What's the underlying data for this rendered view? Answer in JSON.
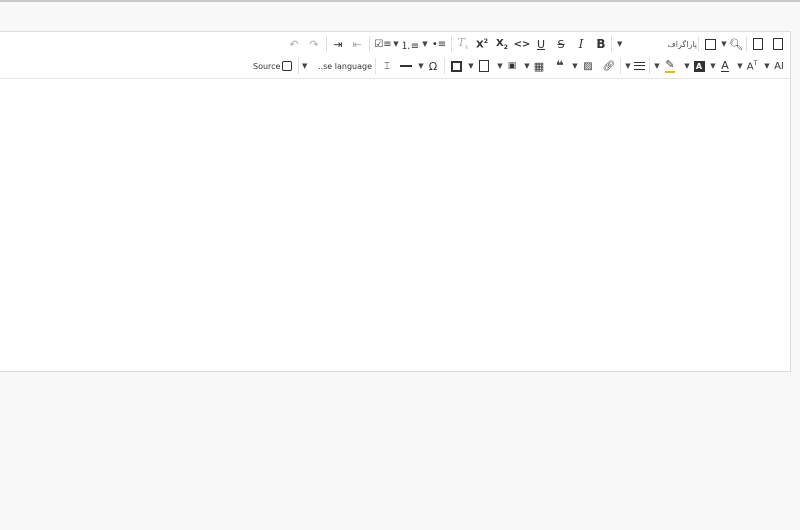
{
  "toolbar": {
    "row1": {
      "source_doc_label": "",
      "format_dropdown_label": "پاراگراف"
    },
    "row2": {
      "source_label": "Source",
      "language_label": "..se language",
      "ai_label": "AI"
    }
  },
  "colors": {
    "background": "#f8f8f8",
    "editor_bg": "#ffffff",
    "border": "#dcdcdc",
    "icon": "#333333",
    "disabled_icon": "#aaaaaa"
  },
  "icons": [
    "undo-icon",
    "redo-icon",
    "indent-icon",
    "outdent-icon",
    "todo-list-icon",
    "numbered-list-icon",
    "bulleted-list-icon",
    "remove-format-icon",
    "superscript-icon",
    "subscript-icon",
    "code-icon",
    "underline-icon",
    "strikethrough-icon",
    "italic-icon",
    "bold-icon",
    "paragraph-dropdown-icon",
    "find-replace-icon",
    "export-word-icon",
    "export-pdf-icon",
    "source-icon",
    "language-icon",
    "page-break-icon",
    "horizontal-line-icon",
    "special-chars-icon",
    "template-icon",
    "form-icon",
    "media-icon",
    "table-icon",
    "blockquote-icon",
    "image-icon",
    "link-icon",
    "align-icon",
    "highlight-icon",
    "bg-color-icon",
    "font-color-icon",
    "font-size-icon",
    "ai-assistant-icon"
  ]
}
